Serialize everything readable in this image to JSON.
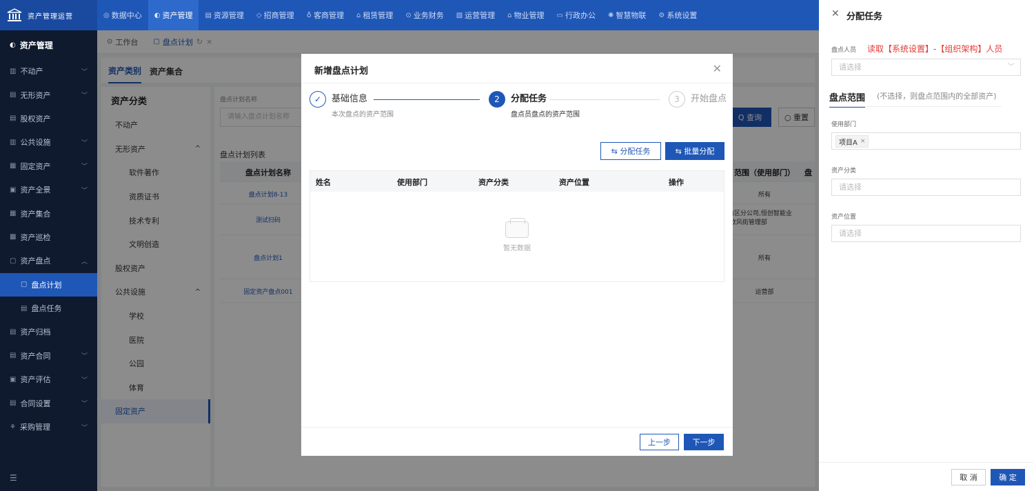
{
  "app": {
    "logo_text": "资产管理运营"
  },
  "topnav": [
    {
      "icon": "◎",
      "label": "数据中心"
    },
    {
      "icon": "◐",
      "label": "资产管理"
    },
    {
      "icon": "▤",
      "label": "资源管理"
    },
    {
      "icon": "◇",
      "label": "招商管理"
    },
    {
      "icon": "♁",
      "label": "客商管理"
    },
    {
      "icon": "⌂",
      "label": "租赁管理"
    },
    {
      "icon": "⊙",
      "label": "业务财务"
    },
    {
      "icon": "▧",
      "label": "运营管理"
    },
    {
      "icon": "⌂",
      "label": "物业管理"
    },
    {
      "icon": "▭",
      "label": "行政办公"
    },
    {
      "icon": "✺",
      "label": "智慧物联"
    },
    {
      "icon": "⚙",
      "label": "系统设置"
    }
  ],
  "sidebar": {
    "header": "资产管理",
    "items": [
      {
        "label": "不动产",
        "icon": "▥",
        "chevron": "﹀"
      },
      {
        "label": "无形资产",
        "icon": "▤",
        "chevron": "﹀"
      },
      {
        "label": "股权资产",
        "icon": "▤",
        "chevron": ""
      },
      {
        "label": "公共设施",
        "icon": "▥",
        "chevron": "﹀"
      },
      {
        "label": "固定资产",
        "icon": "▦",
        "chevron": "﹀"
      },
      {
        "label": "资产全景",
        "icon": "▣",
        "chevron": "﹀"
      },
      {
        "label": "资产集合",
        "icon": "▦",
        "chevron": ""
      },
      {
        "label": "资产巡检",
        "icon": "▩",
        "chevron": ""
      },
      {
        "label": "资产盘点",
        "icon": "▢",
        "chevron": "︿"
      }
    ],
    "subitems": [
      {
        "label": "盘点计划",
        "icon": "▢"
      },
      {
        "label": "盘点任务",
        "icon": "▤"
      }
    ],
    "items_after": [
      {
        "label": "资产归档",
        "icon": "▤",
        "chevron": ""
      },
      {
        "label": "资产合同",
        "icon": "▤",
        "chevron": "﹀"
      },
      {
        "label": "资产评估",
        "icon": "▣",
        "chevron": "﹀"
      },
      {
        "label": "合同设置",
        "icon": "▤",
        "chevron": "﹀"
      },
      {
        "label": "采购管理",
        "icon": "⚘",
        "chevron": "﹀"
      }
    ],
    "collapse_icon": "☰"
  },
  "tabs": [
    {
      "icon": "⊙",
      "label": "工作台"
    },
    {
      "icon": "▢",
      "label": "盘点计划"
    }
  ],
  "content": {
    "category_tabs": [
      "资产类别",
      "资产集合"
    ],
    "tree": {
      "title": "资产分类",
      "items": [
        {
          "label": "不动产",
          "level": 1,
          "chevron": ""
        },
        {
          "label": "无形资产",
          "level": 1,
          "chevron": "^"
        },
        {
          "label": "软件著作",
          "level": 2,
          "chevron": ""
        },
        {
          "label": "资质证书",
          "level": 2,
          "chevron": ""
        },
        {
          "label": "技术专利",
          "level": 2,
          "chevron": ""
        },
        {
          "label": "文明创造",
          "level": 2,
          "chevron": ""
        },
        {
          "label": "股权资产",
          "level": 1,
          "chevron": ""
        },
        {
          "label": "公共设施",
          "level": 1,
          "chevron": "^"
        },
        {
          "label": "学校",
          "level": 2,
          "chevron": ""
        },
        {
          "label": "医院",
          "level": 2,
          "chevron": ""
        },
        {
          "label": "公园",
          "level": 2,
          "chevron": ""
        },
        {
          "label": "体育",
          "level": 2,
          "chevron": ""
        },
        {
          "label": "固定资产",
          "level": 1,
          "chevron": ""
        }
      ]
    },
    "list": {
      "filter_label": "盘点计划名称",
      "filter_placeholder": "请输入盘点计划名称",
      "query_label": "Q 查询",
      "reset_label": "○ 重置",
      "title": "盘点计划列表",
      "header": {
        "name": "盘点计划名称",
        "scope": "范围（使用部门）",
        "extra": "盘"
      },
      "rows": [
        {
          "name": "盘点计划8-13",
          "scope": "所有"
        },
        {
          "name": "测试扫码",
          "scope": "华南区分公司,恒创智能业部,欧风街管理部"
        },
        {
          "name": "盘点计划1",
          "scope": "所有"
        },
        {
          "name": "固定资产盘点001",
          "scope": "运营部"
        }
      ]
    }
  },
  "modal": {
    "title": "新增盘点计划",
    "steps": [
      {
        "num": "✓",
        "title": "基础信息",
        "desc": "本次盘点的资产范围"
      },
      {
        "num": "2",
        "title": "分配任务",
        "desc": "盘点员盘点的资产范围"
      },
      {
        "num": "3",
        "title": "开始盘点",
        "desc": ""
      }
    ],
    "assign_btn": "⇆ 分配任务",
    "batch_btn": "⇆ 批量分配",
    "table_headers": [
      "姓名",
      "使用部门",
      "资产分类",
      "资产位置",
      "操作"
    ],
    "empty_text": "暂无数据",
    "prev_btn": "上一步",
    "next_btn": "下一步"
  },
  "drawer": {
    "title": "分配任务",
    "person_label": "盘点人员",
    "person_note": "读取【系统设置】-【组织架构】人员",
    "person_placeholder": "请选择",
    "scope_title": "盘点范围",
    "scope_note": "(不选择，则盘点范围内的全部资产)",
    "dept_label": "使用部门",
    "dept_tag": "项目A",
    "category_label": "资产分类",
    "category_placeholder": "请选择",
    "location_label": "资产位置",
    "location_placeholder": "请选择",
    "cancel_btn": "取 消",
    "ok_btn": "确 定"
  }
}
